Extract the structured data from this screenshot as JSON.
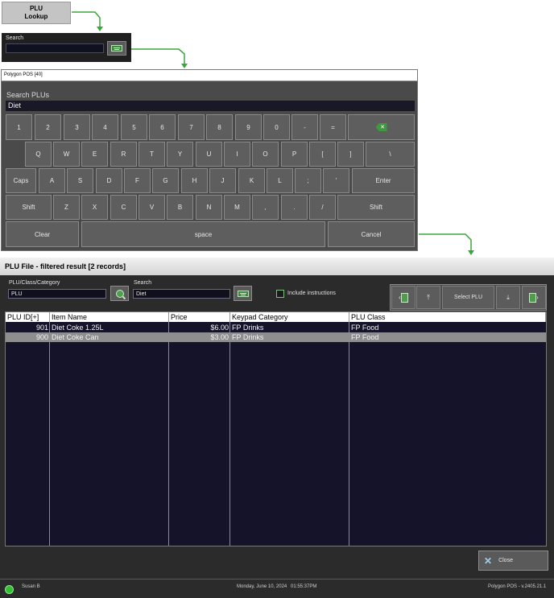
{
  "plu_lookup": {
    "line1": "PLU",
    "line2": "Lookup"
  },
  "search_mini": {
    "label": "Search"
  },
  "keyboard_window": {
    "title": "Polygon POS  [40]",
    "search_label": "Search PLUs",
    "search_value": "Diet",
    "rows": [
      [
        "1",
        "2",
        "3",
        "4",
        "5",
        "6",
        "7",
        "8",
        "9",
        "0",
        "-",
        "="
      ],
      [
        "Q",
        "W",
        "E",
        "R",
        "T",
        "Y",
        "U",
        "I",
        "O",
        "P",
        "[",
        "]",
        "\\"
      ],
      [
        "Caps",
        "A",
        "S",
        "D",
        "F",
        "G",
        "H",
        "J",
        "K",
        "L",
        ";",
        "'",
        "Enter"
      ],
      [
        "Shift",
        "Z",
        "X",
        "C",
        "V",
        "B",
        "N",
        "M",
        ",",
        ".",
        "/",
        "Shift"
      ],
      [
        "Clear",
        "space",
        "Cancel"
      ]
    ]
  },
  "main": {
    "title": "PLU File - filtered result [2 records]",
    "filter_label": "PLU/Class/Category",
    "filter_value": "PLU",
    "search_label": "Search",
    "search_value": "Diet",
    "include_instructions": "Include instructions",
    "select_plu": "Select PLU",
    "columns": [
      "PLU ID[+]",
      "Item Name",
      "Price",
      "Keypad Category",
      "PLU Class"
    ],
    "rows": [
      [
        "901",
        "Diet Coke 1.25L",
        "$6.00",
        "FP Drinks",
        "FP Food"
      ],
      [
        "900",
        "Diet Coke Can",
        "$3.00",
        "FP Drinks",
        "FP Food"
      ]
    ],
    "close": "Close"
  },
  "status": {
    "user": "Susan B",
    "date": "Monday, June 10, 2024",
    "time": "01:55:37PM",
    "version": "Polygon POS - v.2405.21.1"
  },
  "colors": {
    "accent_green": "#3f9a3f",
    "grid_bg": "#14132a",
    "selected_row": "#8e8e8e"
  },
  "icons": [
    "keyboard-icon",
    "search-icon",
    "backspace-icon",
    "page-prev-icon",
    "page-first-icon",
    "page-last-icon",
    "page-next-icon",
    "close-icon"
  ]
}
